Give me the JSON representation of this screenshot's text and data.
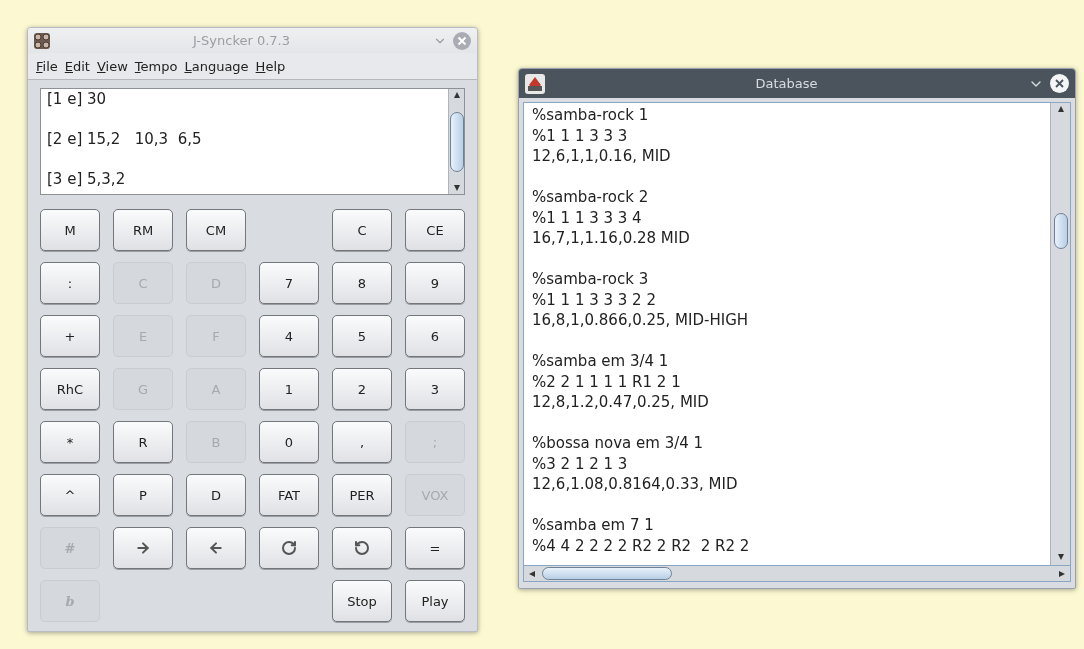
{
  "calculator_window": {
    "title": "J-Syncker 0.7.3",
    "menu": [
      "File",
      "Edit",
      "View",
      "Tempo",
      "Language",
      "Help"
    ],
    "display_lines": [
      "[1 e] 30",
      "[2 e] 15,2   10,3  6,5",
      "[3 e] 5,3,2"
    ],
    "buttons": [
      {
        "kind": "text",
        "label": "M",
        "disabled": false
      },
      {
        "kind": "text",
        "label": "RM",
        "disabled": false
      },
      {
        "kind": "text",
        "label": "CM",
        "disabled": false
      },
      {
        "kind": "blank"
      },
      {
        "kind": "text",
        "label": "C",
        "disabled": false
      },
      {
        "kind": "text",
        "label": "CE",
        "disabled": false
      },
      {
        "kind": "text",
        "label": ":",
        "disabled": false
      },
      {
        "kind": "text",
        "label": "C",
        "disabled": true
      },
      {
        "kind": "text",
        "label": "D",
        "disabled": true
      },
      {
        "kind": "text",
        "label": "7",
        "disabled": false
      },
      {
        "kind": "text",
        "label": "8",
        "disabled": false
      },
      {
        "kind": "text",
        "label": "9",
        "disabled": false
      },
      {
        "kind": "text",
        "label": "+",
        "disabled": false
      },
      {
        "kind": "text",
        "label": "E",
        "disabled": true
      },
      {
        "kind": "text",
        "label": "F",
        "disabled": true
      },
      {
        "kind": "text",
        "label": "4",
        "disabled": false
      },
      {
        "kind": "text",
        "label": "5",
        "disabled": false
      },
      {
        "kind": "text",
        "label": "6",
        "disabled": false
      },
      {
        "kind": "text",
        "label": "RhC",
        "disabled": false
      },
      {
        "kind": "text",
        "label": "G",
        "disabled": true
      },
      {
        "kind": "text",
        "label": "A",
        "disabled": true
      },
      {
        "kind": "text",
        "label": "1",
        "disabled": false
      },
      {
        "kind": "text",
        "label": "2",
        "disabled": false
      },
      {
        "kind": "text",
        "label": "3",
        "disabled": false
      },
      {
        "kind": "text",
        "label": "*",
        "disabled": false
      },
      {
        "kind": "text",
        "label": "R",
        "disabled": false
      },
      {
        "kind": "text",
        "label": "B",
        "disabled": true
      },
      {
        "kind": "text",
        "label": "0",
        "disabled": false
      },
      {
        "kind": "text",
        "label": ",",
        "disabled": false
      },
      {
        "kind": "text",
        "label": ";",
        "disabled": true
      },
      {
        "kind": "text",
        "label": "^",
        "disabled": false
      },
      {
        "kind": "text",
        "label": "P",
        "disabled": false
      },
      {
        "kind": "text",
        "label": "D",
        "disabled": false
      },
      {
        "kind": "text",
        "label": "FAT",
        "disabled": false
      },
      {
        "kind": "text",
        "label": "PER",
        "disabled": false
      },
      {
        "kind": "text",
        "label": "VOX",
        "disabled": true
      },
      {
        "kind": "symbol",
        "label": "#",
        "disabled": true
      },
      {
        "kind": "forward",
        "disabled": false
      },
      {
        "kind": "back",
        "disabled": false
      },
      {
        "kind": "redo",
        "disabled": false
      },
      {
        "kind": "undo",
        "disabled": false
      },
      {
        "kind": "text",
        "label": "=",
        "disabled": false
      },
      {
        "kind": "symbol",
        "label": "b",
        "disabled": true
      },
      {
        "kind": "blank"
      },
      {
        "kind": "blank"
      },
      {
        "kind": "blank"
      },
      {
        "kind": "text",
        "label": "Stop",
        "disabled": false
      },
      {
        "kind": "text",
        "label": "Play",
        "disabled": false
      }
    ]
  },
  "database_window": {
    "title": "Database",
    "entries": [
      [
        "%samba-rock 1",
        "%1 1 1 3 3 3",
        "12,6,1,1,0.16, MID"
      ],
      [
        "%samba-rock 2",
        "%1 1 1 3 3 3 4",
        "16,7,1,1.16,0.28 MID"
      ],
      [
        "%samba-rock 3",
        "%1 1 1 3 3 3 2 2",
        "16,8,1,0.866,0.25, MID-HIGH"
      ],
      [
        "%samba em 3/4 1",
        "%2 2 1 1 1 1 R1 2 1",
        "12,8,1.2,0.47,0.25, MID"
      ],
      [
        "%bossa nova em 3/4 1",
        "%3 2 1 2 1 3",
        "12,6,1.08,0.8164,0.33, MID"
      ],
      [
        "%samba em 7 1",
        "%4 4 2 2 2 2 R2 2 R2  2 R2 2"
      ]
    ]
  }
}
